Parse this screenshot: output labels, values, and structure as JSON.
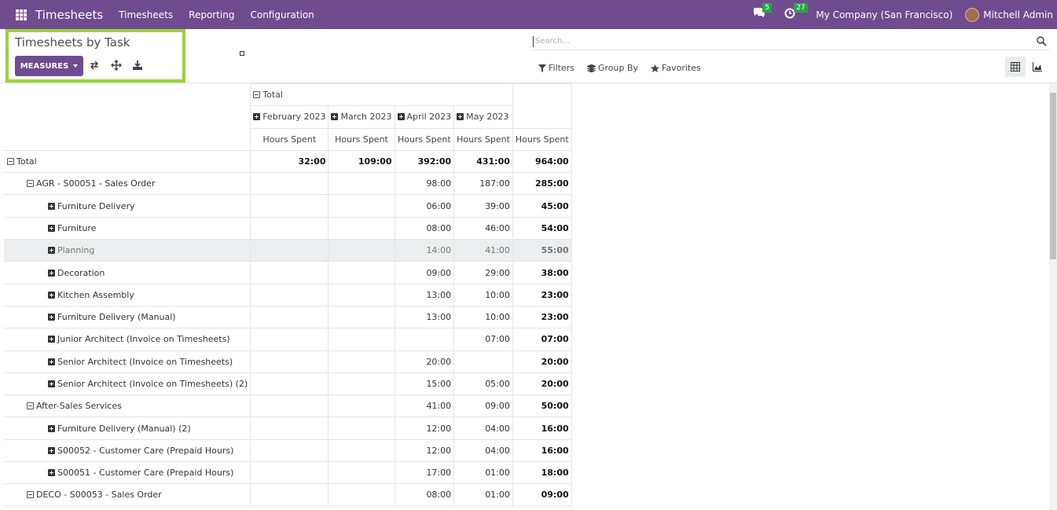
{
  "navbar": {
    "app_name": "Timesheets",
    "menu": [
      "Timesheets",
      "Reporting",
      "Configuration"
    ],
    "messages_count": "5",
    "activities_count": "27",
    "company": "My Company (San Francisco)",
    "user": "Mitchell Admin",
    "accent_color": "#714b8f"
  },
  "control_panel": {
    "title": "Timesheets by Task",
    "measures_label": "MEASURES",
    "search_placeholder": "Search...",
    "filters_label": "Filters",
    "group_by_label": "Group By",
    "favorites_label": "Favorites",
    "tool_icons": [
      "flip-axis-icon",
      "expand-all-icon",
      "download-icon"
    ],
    "view_icons": [
      "pivot-view-icon",
      "graph-view-icon"
    ]
  },
  "pivot": {
    "col_total_label": "Total",
    "months": [
      "February 2023",
      "March 2023",
      "April 2023",
      "May 2023"
    ],
    "measure": "Hours Spent",
    "rows": [
      {
        "label": "Total",
        "level": 0,
        "expanded": true,
        "cells": [
          "32:00",
          "109:00",
          "392:00",
          "431:00",
          "964:00"
        ]
      },
      {
        "label": "AGR - S00051 - Sales Order",
        "level": 1,
        "expanded": true,
        "cells": [
          "",
          "",
          "98:00",
          "187:00",
          "285:00"
        ]
      },
      {
        "label": "Furniture Delivery",
        "level": 2,
        "expanded": false,
        "cells": [
          "",
          "",
          "06:00",
          "39:00",
          "45:00"
        ]
      },
      {
        "label": "Furniture",
        "level": 2,
        "expanded": false,
        "cells": [
          "",
          "",
          "08:00",
          "46:00",
          "54:00"
        ]
      },
      {
        "label": "Planning",
        "level": 2,
        "expanded": false,
        "hover": true,
        "cells": [
          "",
          "",
          "14:00",
          "41:00",
          "55:00"
        ]
      },
      {
        "label": "Decoration",
        "level": 2,
        "expanded": false,
        "cells": [
          "",
          "",
          "09:00",
          "29:00",
          "38:00"
        ]
      },
      {
        "label": "Kitchen Assembly",
        "level": 2,
        "expanded": false,
        "cells": [
          "",
          "",
          "13:00",
          "10:00",
          "23:00"
        ]
      },
      {
        "label": "Furniture Delivery (Manual)",
        "level": 2,
        "expanded": false,
        "cells": [
          "",
          "",
          "13:00",
          "10:00",
          "23:00"
        ]
      },
      {
        "label": "Junior Architect (Invoice on Timesheets)",
        "level": 2,
        "expanded": false,
        "cells": [
          "",
          "",
          "",
          "07:00",
          "07:00"
        ]
      },
      {
        "label": "Senior Architect (Invoice on Timesheets)",
        "level": 2,
        "expanded": false,
        "cells": [
          "",
          "",
          "20:00",
          "",
          "20:00"
        ]
      },
      {
        "label": "Senior Architect (Invoice on Timesheets) (2)",
        "level": 2,
        "expanded": false,
        "cells": [
          "",
          "",
          "15:00",
          "05:00",
          "20:00"
        ]
      },
      {
        "label": "After-Sales Services",
        "level": 1,
        "expanded": true,
        "cells": [
          "",
          "",
          "41:00",
          "09:00",
          "50:00"
        ]
      },
      {
        "label": "Furniture Delivery (Manual) (2)",
        "level": 2,
        "expanded": false,
        "cells": [
          "",
          "",
          "12:00",
          "04:00",
          "16:00"
        ]
      },
      {
        "label": "S00052 - Customer Care (Prepaid Hours)",
        "level": 2,
        "expanded": false,
        "cells": [
          "",
          "",
          "12:00",
          "04:00",
          "16:00"
        ]
      },
      {
        "label": "S00051 - Customer Care (Prepaid Hours)",
        "level": 2,
        "expanded": false,
        "cells": [
          "",
          "",
          "17:00",
          "01:00",
          "18:00"
        ]
      },
      {
        "label": "DECO - S00053 - Sales Order",
        "level": 1,
        "expanded": true,
        "cells": [
          "",
          "",
          "08:00",
          "01:00",
          "09:00"
        ]
      }
    ]
  }
}
